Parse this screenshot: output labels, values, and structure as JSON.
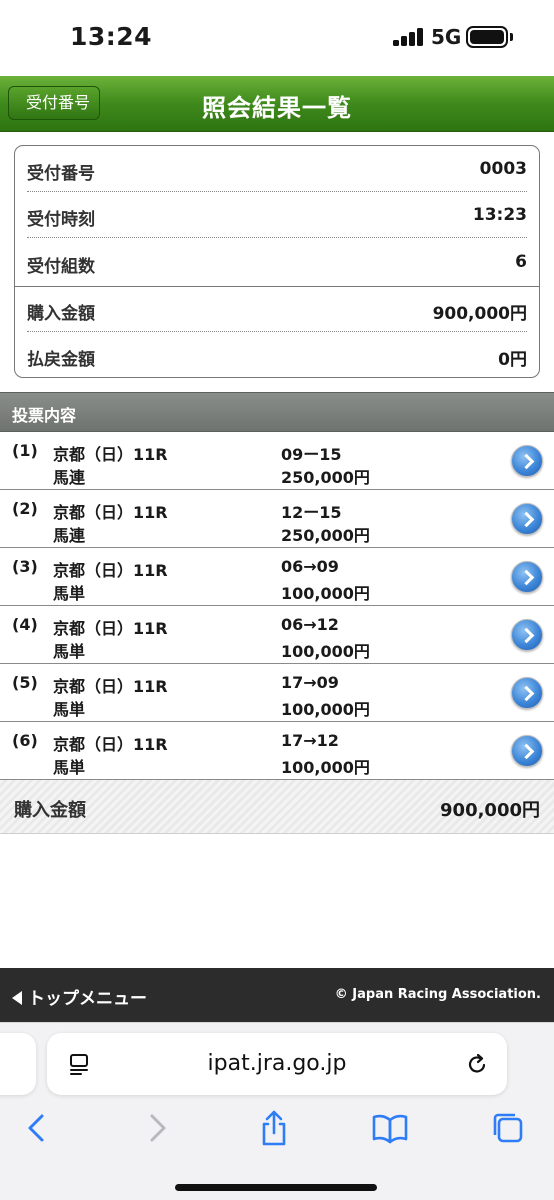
{
  "status_bar": {
    "time": "13:24",
    "network": "5G"
  },
  "header": {
    "back_label": "受付番号",
    "title": "照会結果一覧"
  },
  "summary": {
    "rows": [
      {
        "label": "受付番号",
        "value": "0003"
      },
      {
        "label": "受付時刻",
        "value": "13:23"
      },
      {
        "label": "受付組数",
        "value": "6"
      },
      {
        "label": "購入金額",
        "value": "900,000円"
      },
      {
        "label": "払戻金額",
        "value": "0円"
      }
    ]
  },
  "section": {
    "title": "投票内容"
  },
  "bets": [
    {
      "num": "(1)",
      "race": "京都（日）11R",
      "type": "馬連",
      "combo": "09ー15",
      "amount": "250,000円"
    },
    {
      "num": "(2)",
      "race": "京都（日）11R",
      "type": "馬連",
      "combo": "12ー15",
      "amount": "250,000円"
    },
    {
      "num": "(3)",
      "race": "京都（日）11R",
      "type": "馬単",
      "combo": "06→09",
      "amount": "100,000円"
    },
    {
      "num": "(4)",
      "race": "京都（日）11R",
      "type": "馬単",
      "combo": "06→12",
      "amount": "100,000円"
    },
    {
      "num": "(5)",
      "race": "京都（日）11R",
      "type": "馬単",
      "combo": "17→09",
      "amount": "100,000円"
    },
    {
      "num": "(6)",
      "race": "京都（日）11R",
      "type": "馬単",
      "combo": "17→12",
      "amount": "100,000円"
    }
  ],
  "total": {
    "label": "購入金額",
    "value": "900,000円"
  },
  "footer": {
    "menu_label": "トップメニュー",
    "copyright": "© Japan Racing Association."
  },
  "browser": {
    "url": "ipat.jra.go.jp"
  }
}
